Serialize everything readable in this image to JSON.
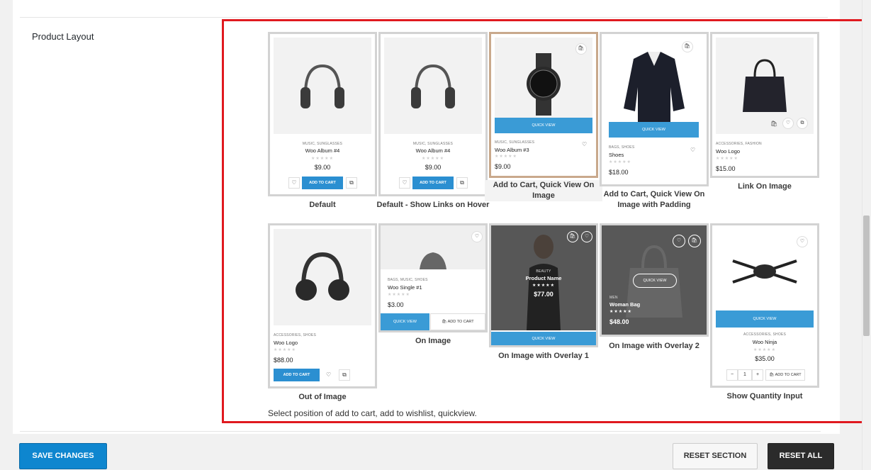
{
  "section": {
    "label": "Product Layout",
    "description": "Select position of add to cart, add to wishlist, quickview."
  },
  "options": [
    {
      "caption": "Default",
      "category": "MUSIC, SUNGLASSES",
      "product": "Woo Album #4",
      "price": "$9.00",
      "button": "ADD TO CART",
      "image": "headphones-icon"
    },
    {
      "caption": "Default - Show Links on Hover",
      "category": "MUSIC, SUNGLASSES",
      "product": "Woo Album #4",
      "price": "$9.00",
      "button": "ADD TO CART",
      "image": "headphones-icon"
    },
    {
      "caption": "Add to Cart, Quick View On Image",
      "category": "MUSIC, SUNGLASSES",
      "product": "Woo Album #3",
      "price": "$9.00",
      "button": "QUICK VIEW",
      "image": "watch-icon",
      "selected": true
    },
    {
      "caption": "Add to Cart, Quick View On Image with Padding",
      "category": "BAGS, SHOES",
      "product": "Shoes",
      "price": "$18.00",
      "button": "QUICK VIEW",
      "image": "jacket-icon"
    },
    {
      "caption": "Link On Image",
      "category": "ACCESSORIES, FASHION",
      "product": "Woo Logo",
      "price": "$15.00",
      "image": "handbag-icon"
    },
    {
      "caption": "Out of Image",
      "category": "ACCESSORIES, SHOES",
      "product": "Woo Logo",
      "price": "$88.00",
      "button": "ADD TO CART",
      "image": "headphones-icon"
    },
    {
      "caption": "On Image",
      "category": "BAGS, MUSIC, SHOES",
      "product": "Woo Single #1",
      "price": "$3.00",
      "button": "QUICK VIEW",
      "button2": "ADD TO CART",
      "image": "hat-icon"
    },
    {
      "caption": "On Image with Overlay 1",
      "category": "BEAUTY",
      "product": "Product Name",
      "price": "$77.00",
      "button": "QUICK VIEW",
      "image": "woman-icon"
    },
    {
      "caption": "On Image with Overlay 2",
      "category": "MEN",
      "product": "Woman Bag",
      "price": "$48.00",
      "button": "QUICK VIEW",
      "image": "bag-icon"
    },
    {
      "caption": "Show Quantity Input",
      "category": "ACCESSORIES, SHOES",
      "product": "Woo Ninja",
      "price": "$35.00",
      "button": "QUICK VIEW",
      "button2": "ADD TO CART",
      "qty": "1",
      "image": "drone-icon"
    }
  ],
  "footer": {
    "save": "SAVE CHANGES",
    "reset_section": "RESET SECTION",
    "reset_all": "RESET ALL"
  },
  "colors": {
    "accent": "#2b8fd1",
    "highlight": "#e0191f",
    "dark_button": "#2b2b2b"
  }
}
